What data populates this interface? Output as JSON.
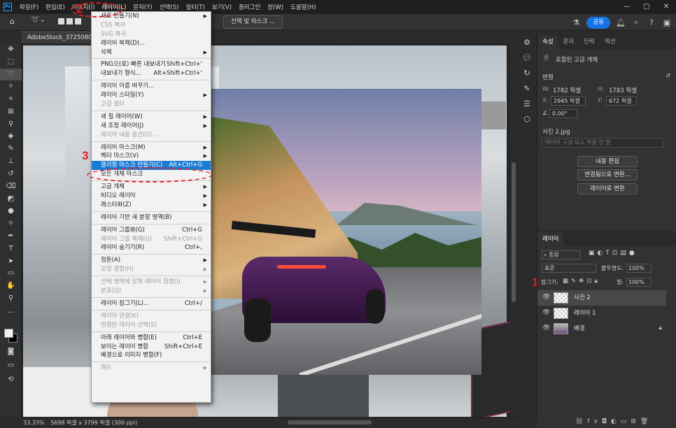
{
  "menubar": {
    "logo": "Ps",
    "items": [
      "파일(F)",
      "편집(E)",
      "이미지(I)",
      "레이어(L)",
      "문자(Y)",
      "선택(S)",
      "필터(T)",
      "보기(V)",
      "플러그인",
      "창(W)",
      "도움말(H)"
    ],
    "window_controls": [
      "—",
      "▢",
      "✕"
    ]
  },
  "options": {
    "select_mask_label": "선택 및 마스크 ...",
    "share_label": "공유"
  },
  "doc_tab": "AdobeStock_372508044.j...",
  "layer_menu": {
    "items": [
      {
        "label": "새로 만들기(N)",
        "shortcut": "",
        "arrow": true,
        "disabled": false
      },
      {
        "label": "CSS 복사",
        "shortcut": "",
        "arrow": false,
        "disabled": true
      },
      {
        "label": "SVG 복사",
        "shortcut": "",
        "arrow": false,
        "disabled": true
      },
      {
        "label": "레이어 복제(D)...",
        "shortcut": "",
        "arrow": false,
        "disabled": false
      },
      {
        "label": "삭제",
        "shortcut": "",
        "arrow": true,
        "disabled": false
      },
      {
        "sep": true
      },
      {
        "label": "PNG으(로) 빠른 내보내기",
        "shortcut": "Shift+Ctrl+'",
        "arrow": false,
        "disabled": false
      },
      {
        "label": "내보내기 형식...",
        "shortcut": "Alt+Shift+Ctrl+'",
        "arrow": false,
        "disabled": false
      },
      {
        "sep": true
      },
      {
        "label": "레이어 이름 바꾸기...",
        "shortcut": "",
        "arrow": false,
        "disabled": false
      },
      {
        "label": "레이어 스타일(Y)",
        "shortcut": "",
        "arrow": true,
        "disabled": false
      },
      {
        "label": "고급 필터",
        "shortcut": "",
        "arrow": false,
        "disabled": true
      },
      {
        "sep": true
      },
      {
        "label": "새 칠 레이어(W)",
        "shortcut": "",
        "arrow": true,
        "disabled": false
      },
      {
        "label": "새 조정 레이어(J)",
        "shortcut": "",
        "arrow": true,
        "disabled": false
      },
      {
        "label": "레이어 내용 옵션(O)...",
        "shortcut": "",
        "arrow": false,
        "disabled": true
      },
      {
        "sep": true
      },
      {
        "label": "레이어 마스크(M)",
        "shortcut": "",
        "arrow": true,
        "disabled": false
      },
      {
        "label": "벡터 마스크(V)",
        "shortcut": "",
        "arrow": true,
        "disabled": false
      },
      {
        "label": "클리핑 마스크 만들기(C)",
        "shortcut": "Alt+Ctrl+G",
        "arrow": false,
        "disabled": false,
        "highlight": true
      },
      {
        "label": "모든 개체 마스크",
        "shortcut": "",
        "arrow": false,
        "disabled": false
      },
      {
        "sep": true
      },
      {
        "label": "고급 개체",
        "shortcut": "",
        "arrow": true,
        "disabled": false
      },
      {
        "label": "비디오 레이어",
        "shortcut": "",
        "arrow": true,
        "disabled": false
      },
      {
        "label": "래스터화(Z)",
        "shortcut": "",
        "arrow": true,
        "disabled": false
      },
      {
        "sep": true
      },
      {
        "label": "레이어 기반 새 분할 영역(B)",
        "shortcut": "",
        "arrow": false,
        "disabled": false
      },
      {
        "sep": true
      },
      {
        "label": "레이어 그룹화(G)",
        "shortcut": "Ctrl+G",
        "arrow": false,
        "disabled": false
      },
      {
        "label": "레이어 그룹 해제(U)",
        "shortcut": "Shift+Ctrl+G",
        "arrow": false,
        "disabled": true
      },
      {
        "label": "레이어 숨기기(R)",
        "shortcut": "Ctrl+,",
        "arrow": false,
        "disabled": false
      },
      {
        "sep": true
      },
      {
        "label": "정돈(A)",
        "shortcut": "",
        "arrow": true,
        "disabled": false
      },
      {
        "label": "모양 결합(H)",
        "shortcut": "",
        "arrow": true,
        "disabled": true
      },
      {
        "sep": true
      },
      {
        "label": "선택 영역에 맞춰 레이어 정렬(I)",
        "shortcut": "",
        "arrow": true,
        "disabled": true
      },
      {
        "label": "분포(Q)",
        "shortcut": "",
        "arrow": true,
        "disabled": true
      },
      {
        "sep": true
      },
      {
        "label": "레이어 잠그기(L)...",
        "shortcut": "Ctrl+/",
        "arrow": false,
        "disabled": false
      },
      {
        "sep": true
      },
      {
        "label": "레이어 연결(K)",
        "shortcut": "",
        "arrow": false,
        "disabled": true
      },
      {
        "label": "연결된 레이어 선택(S)",
        "shortcut": "",
        "arrow": false,
        "disabled": true
      },
      {
        "sep": true
      },
      {
        "label": "아래 레이어와 병합(E)",
        "shortcut": "Ctrl+E",
        "arrow": false,
        "disabled": false
      },
      {
        "label": "보이는 레이어 병합",
        "shortcut": "Shift+Ctrl+E",
        "arrow": false,
        "disabled": false
      },
      {
        "label": "배경으로 이미지 병합(F)",
        "shortcut": "",
        "arrow": false,
        "disabled": false
      },
      {
        "sep": true
      },
      {
        "label": "매트",
        "shortcut": "",
        "arrow": true,
        "disabled": true
      }
    ]
  },
  "annotations": {
    "n1": "1",
    "n2": "2",
    "n3": "3"
  },
  "properties": {
    "tabs": [
      "속성",
      "문자",
      "단락",
      "액션"
    ],
    "object_type": "포함된 고급 개체",
    "transform_label": "변형",
    "w_label": "W:",
    "w_value": "1782 픽셀",
    "h_label": "H:",
    "h_value": "1783 픽셀",
    "x_label": "X:",
    "x_value": "2945 픽셀",
    "y_label": "Y:",
    "y_value": "672 픽셀",
    "angle_value": "0.00°",
    "file_name": "사진 2.jpg",
    "composition_placeholder": "레이어 구성 요소 적용 안 함",
    "btn_edit": "내용 편집",
    "btn_linked": "연결됨으로 변환...",
    "btn_layers": "레이어로 변환"
  },
  "layers": {
    "title": "레이어",
    "kind_filter": "종류",
    "blend_mode": "표준",
    "opacity_label": "불투명도:",
    "opacity_value": "100%",
    "lock_label": "잠그기:",
    "fill_label": "칠:",
    "fill_value": "100%",
    "rows": [
      {
        "name": "사진 2",
        "selected": true
      },
      {
        "name": "레이어 1",
        "selected": false
      },
      {
        "name": "배경",
        "selected": false,
        "locked": true
      }
    ]
  },
  "status": {
    "zoom": "33.33%",
    "doc_info": "5698 픽셀 x 3799 픽셀 (300 ppi)"
  }
}
